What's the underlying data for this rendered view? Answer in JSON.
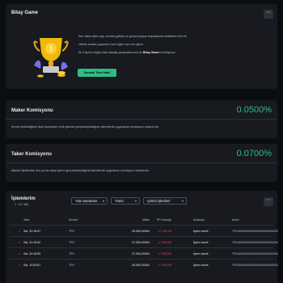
{
  "game": {
    "title": "Bitay Game",
    "lines": [
      {
        "text": "Sıfır riskle işlem yap, kendini geliştir ve gerçek piyasa koşullarında bildiklerini test et!"
      },
      {
        "text": "Üstelik burdan yaparken hem eğlen hem de öğren."
      },
      {
        "pre": "İlk 3 kişinin büyük ödül alacağı yarışmada seni de ",
        "bold": "Bitay Game",
        "post": "'e bekliyoruz."
      }
    ],
    "button_label": "Sanaldi Tara Hakli"
  },
  "maker": {
    "title": "Maker Komisyonu",
    "rate": "0.0500%",
    "description": "Kendi belirlediğiniz fiyat üzerinden emir girerek gerçekleştirdiğiniz işlemlerde uygulanan komisyon oranlarıdır."
  },
  "taker": {
    "title": "Taker Komisyonu",
    "rate": "0.0700%",
    "description": "Market fiyatından alış ya da satış işlemi gerçekleştirdiğiniz işlemlerde uygulanan komisyon oranlarıdır."
  },
  "transactions": {
    "title": "İşlemlerim",
    "pager": "1 - 10 / 364",
    "filters": {
      "time": "Tüm Zamanlar",
      "type": "Tümü",
      "withdraw": "Çekim İşlemleri"
    },
    "headers": {
      "date": "Tarih",
      "symbol": "Sembol",
      "amount": "Miktar",
      "pnl": "TRY karşılığı",
      "desc": "Açıklama",
      "address": "Adres"
    },
    "rows": [
      {
        "date": "Sal, 22:15:57",
        "symbol": "TRY",
        "amount": "25.000,00000",
        "pnl": "-17.000,00",
        "desc": "İşlem ücreti",
        "address": "TR44000000000000000000000000"
      },
      {
        "date": "Sal, 22:15:52",
        "symbol": "TRY",
        "amount": "27.000,00000",
        "pnl": "-17.000,00",
        "desc": "İşlem ücreti",
        "address": "TR44000000000000000000000000"
      },
      {
        "date": "Sal, 22:15:53",
        "symbol": "TRY",
        "amount": "27.000,00000",
        "pnl": "-17.000,00",
        "desc": "İşlem ücreti",
        "address": "TR44000000000000000000000000"
      },
      {
        "date": "Sal, 22:09:57",
        "symbol": "TRY",
        "amount": "25.000,00000",
        "pnl": "-17.000,00",
        "desc": "İşlem ücreti",
        "address": "TR44000000000000000000000000"
      }
    ]
  },
  "colors": {
    "accent_green": "#2ebd85",
    "negative_red": "#f6465d",
    "card_bg": "#181a20",
    "page_bg": "#0b0e11"
  }
}
